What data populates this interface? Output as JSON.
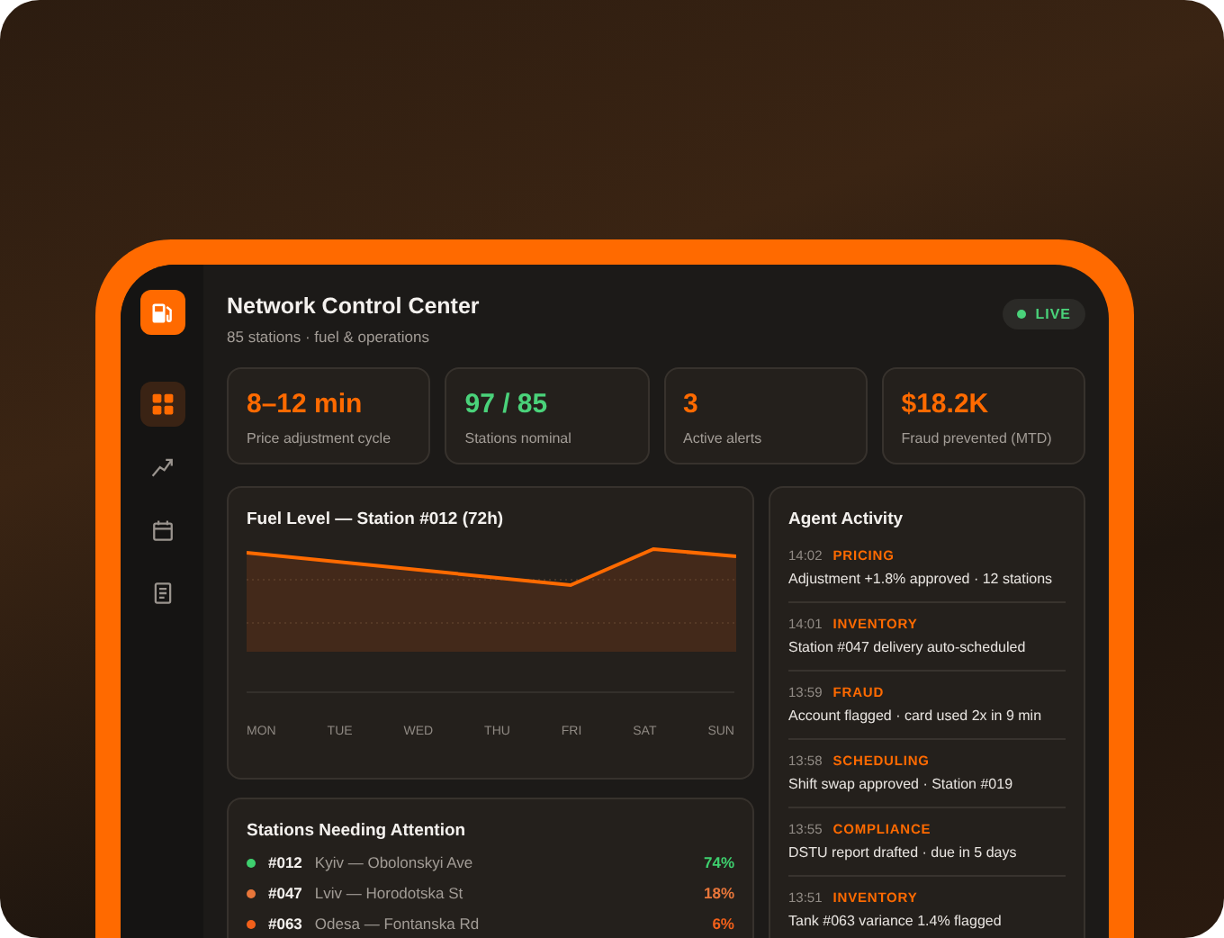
{
  "header": {
    "title": "Network Control Center",
    "subtitle": "85 stations · fuel & operations",
    "status": "LIVE"
  },
  "sidebar": {
    "items": [
      {
        "kind": "grid",
        "selected": true
      },
      {
        "kind": "trend",
        "selected": false
      },
      {
        "kind": "calendar",
        "selected": false
      },
      {
        "kind": "document",
        "selected": false
      }
    ]
  },
  "stats": [
    {
      "value": "8–12 min",
      "label": "Price adjustment cycle",
      "color": "#ff6a00"
    },
    {
      "value": "97 / 85",
      "label": "Stations nominal",
      "color": "#4ad27a"
    },
    {
      "value": "3",
      "label": "Active alerts",
      "color": "#ff6a00"
    },
    {
      "value": "$18.2K",
      "label": "Fraud prevented (MTD)",
      "color": "#ff6a00"
    }
  ],
  "fuel_chart": {
    "title": "Fuel Level — Station #012 (72h)",
    "days": [
      "MON",
      "TUE",
      "WED",
      "THU",
      "FRI",
      "SAT",
      "SUN"
    ]
  },
  "stations": {
    "title": "Stations Needing Attention",
    "rows": [
      {
        "id": "#012",
        "location": "Kyiv — Obolonskyi Ave",
        "level": "74%",
        "color": "#3ecf6e"
      },
      {
        "id": "#047",
        "location": "Lviv — Horodotska St",
        "level": "18%",
        "color": "#e8763a"
      },
      {
        "id": "#063",
        "location": "Odesa — Fontanska Rd",
        "level": "6%",
        "color": "#f2601a"
      }
    ]
  },
  "activity": {
    "title": "Agent Activity",
    "items": [
      {
        "time": "14:02",
        "tag": "PRICING",
        "text": "Adjustment +1.8% approved · 12 stations"
      },
      {
        "time": "14:01",
        "tag": "INVENTORY",
        "text": "Station #047 delivery auto-scheduled"
      },
      {
        "time": "13:59",
        "tag": "FRAUD",
        "text": "Account flagged · card used 2x in 9 min"
      },
      {
        "time": "13:58",
        "tag": "SCHEDULING",
        "text": "Shift swap approved · Station #019"
      },
      {
        "time": "13:55",
        "tag": "COMPLIANCE",
        "text": "DSTU report drafted · due in 5 days"
      },
      {
        "time": "13:51",
        "tag": "INVENTORY",
        "text": "Tank #063 variance 1.4% flagged"
      }
    ]
  }
}
